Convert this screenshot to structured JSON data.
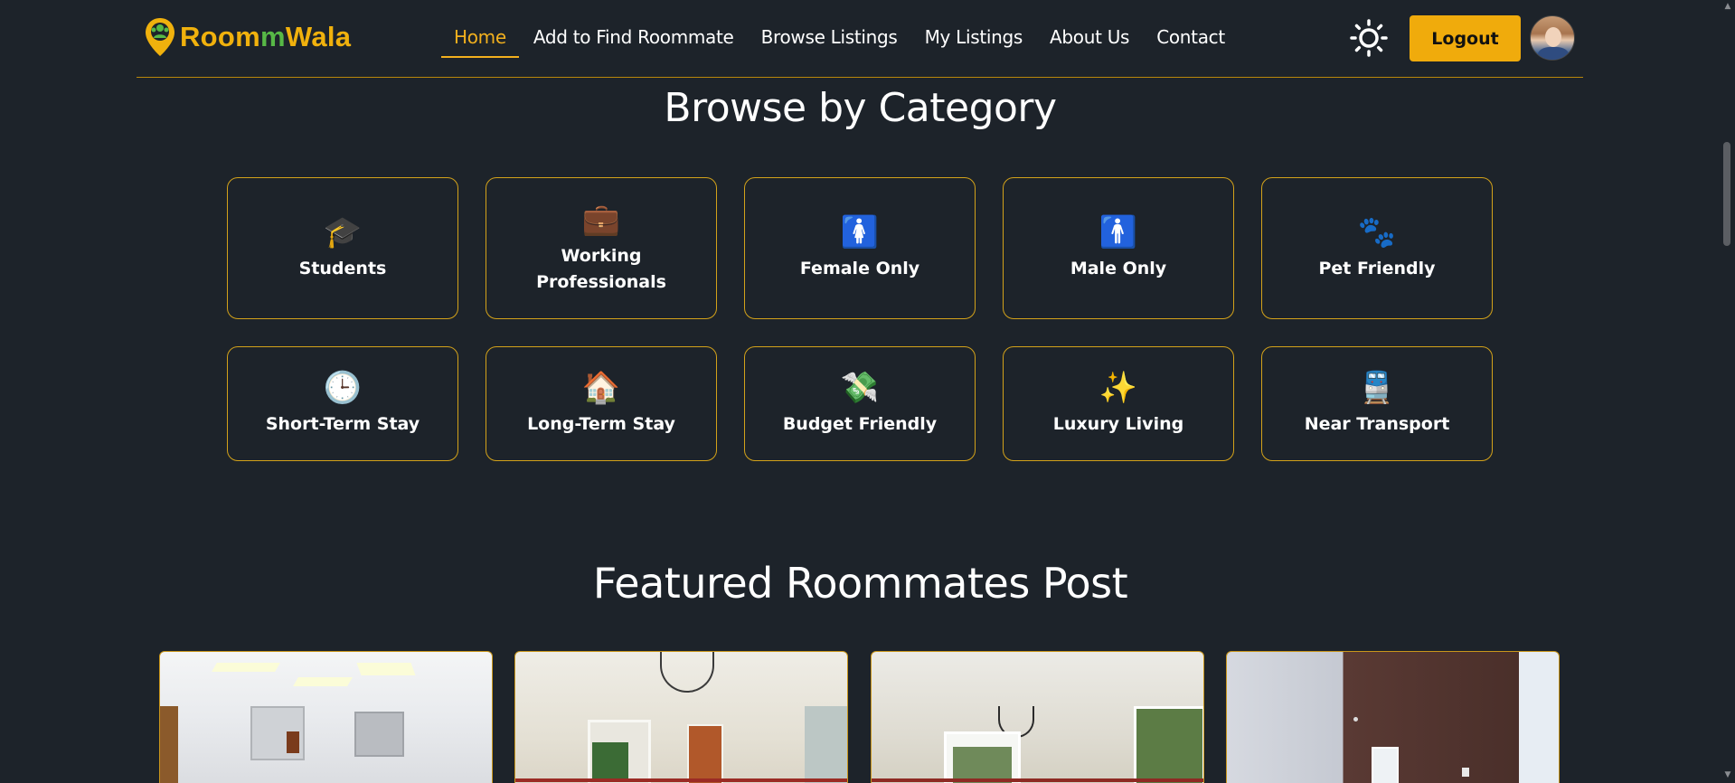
{
  "brand": {
    "name_part1": "Room",
    "name_part2": "m",
    "name_part3": "Wala",
    "accent": "#f0b10d",
    "green": "#57b846"
  },
  "nav": {
    "links": [
      "Home",
      "Add to Find Roommate",
      "Browse Listings",
      "My Listings",
      "About Us",
      "Contact"
    ],
    "active": "Home",
    "theme_icon": "sun-icon",
    "logout_label": "Logout"
  },
  "sections": {
    "browse_title": "Browse by Category",
    "featured_title": "Featured Roommates Post"
  },
  "categories": [
    {
      "label": "Students",
      "icon": "🎓",
      "icon_name": "graduation-cap-icon"
    },
    {
      "label": "Working Professionals",
      "icon": "💼",
      "icon_name": "briefcase-icon"
    },
    {
      "label": "Female Only",
      "icon": "🚺",
      "icon_name": "female-sign-icon"
    },
    {
      "label": "Male Only",
      "icon": "🚹",
      "icon_name": "male-sign-icon"
    },
    {
      "label": "Pet Friendly",
      "icon": "🐾",
      "icon_name": "paw-prints-icon"
    },
    {
      "label": "Short-Term Stay",
      "icon": "🕒",
      "icon_name": "clock-icon"
    },
    {
      "label": "Long-Term Stay",
      "icon": "🏠",
      "icon_name": "house-icon"
    },
    {
      "label": "Budget Friendly",
      "icon": "💸",
      "icon_name": "money-icon"
    },
    {
      "label": "Luxury Living",
      "icon": "✨",
      "icon_name": "sparkles-icon"
    },
    {
      "label": "Near Transport",
      "icon": "🚆",
      "icon_name": "train-icon"
    }
  ],
  "colors": {
    "background": "#1d232a",
    "card_border": "#d3a21a",
    "button": "#f0ab0c"
  }
}
